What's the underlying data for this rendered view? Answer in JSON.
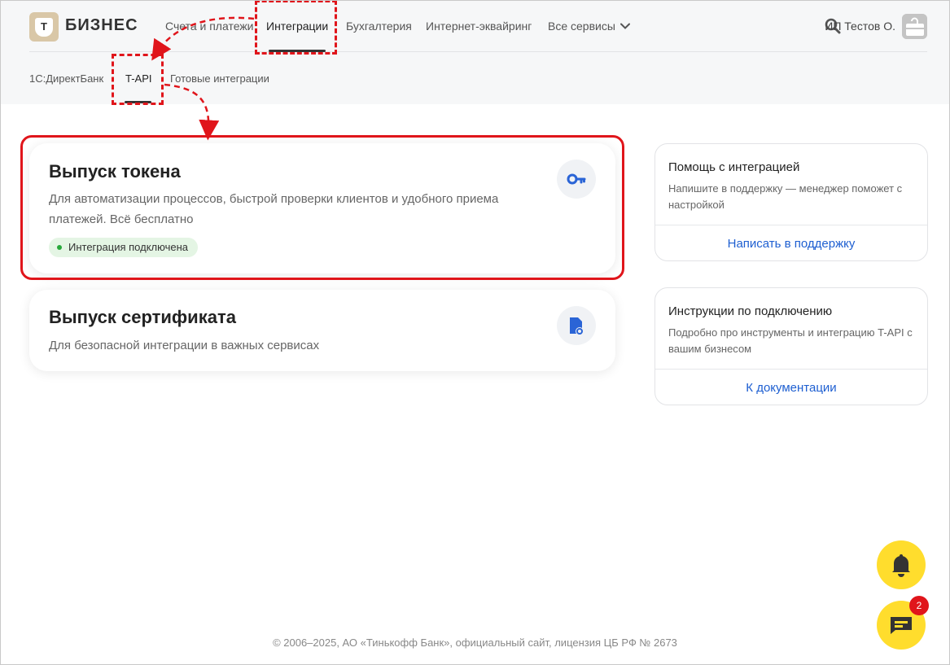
{
  "header": {
    "logo_letter": "Т",
    "brand": "БИЗНЕС",
    "nav": [
      {
        "label": "Счета и платежи"
      },
      {
        "label": "Интеграции"
      },
      {
        "label": "Бухгалтерия"
      },
      {
        "label": "Интернет-эквайринг"
      },
      {
        "label": "Все сервисы"
      }
    ],
    "user_name": "ИП Тестов О."
  },
  "subnav": [
    {
      "label": "1С:ДиректБанк"
    },
    {
      "label": "T-API"
    },
    {
      "label": "Готовые интеграции"
    }
  ],
  "cards": [
    {
      "title": "Выпуск токена",
      "description": "Для автоматизации процессов, быстрой проверки клиентов и удобного приема платежей. Всё бесплатно",
      "badge": "Интеграция подключена"
    },
    {
      "title": "Выпуск сертификата",
      "description": "Для безопасной интеграции в важных сервисах"
    }
  ],
  "panels": [
    {
      "title": "Помощь с интеграцией",
      "description": "Напишите в поддержку — менеджер поможет с настройкой",
      "link": "Написать в поддержку"
    },
    {
      "title": "Инструкции по подключению",
      "description": "Подробно про инструменты и интеграцию T-API с вашим бизнесом",
      "link": "К документации"
    }
  ],
  "chat_badge_count": "2",
  "footer": "© 2006–2025, АО «Тинькофф Банк», официальный сайт, лицензия ЦБ РФ № 2673",
  "colors": {
    "accent_yellow": "#ffdd2d",
    "link_blue": "#1e5fd1",
    "annotation_red": "#e0151b",
    "status_green": "#27a83a"
  }
}
